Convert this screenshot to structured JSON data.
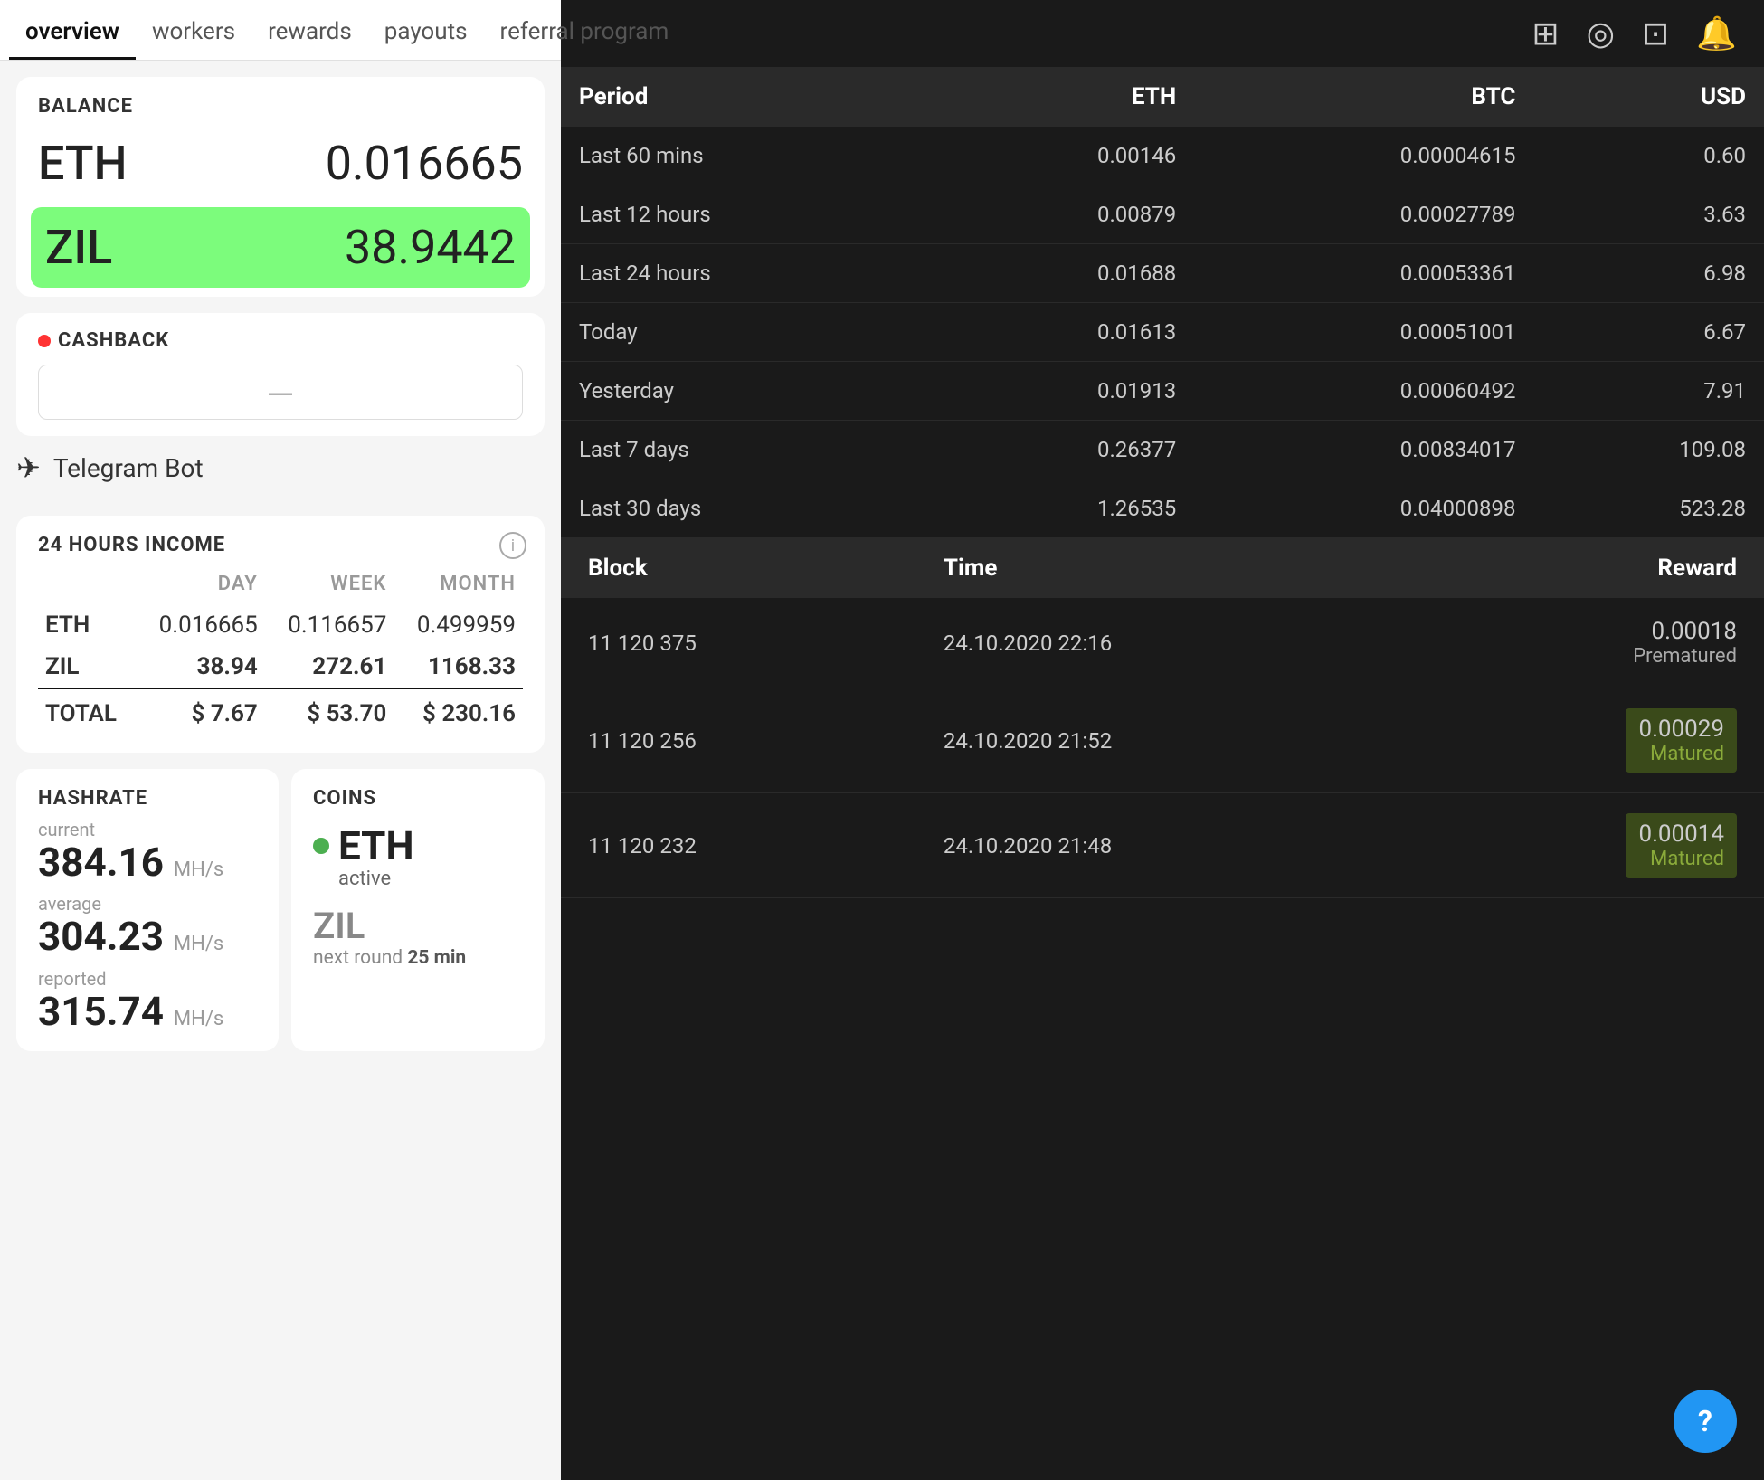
{
  "nav": {
    "tabs": [
      {
        "id": "overview",
        "label": "overview",
        "active": true
      },
      {
        "id": "workers",
        "label": "workers",
        "active": false
      },
      {
        "id": "rewards",
        "label": "rewards",
        "active": false
      },
      {
        "id": "payouts",
        "label": "payouts",
        "active": false
      },
      {
        "id": "referral",
        "label": "referral program",
        "active": false
      }
    ]
  },
  "balance": {
    "label": "BALANCE",
    "eth_coin": "ETH",
    "eth_amount": "0.016665",
    "zil_coin": "ZIL",
    "zil_amount": "38.9442"
  },
  "cashback": {
    "label": "CASHBACK",
    "placeholder": "—"
  },
  "telegram": {
    "label": "Telegram Bot"
  },
  "income": {
    "title": "24 HOURS INCOME",
    "headers": [
      "",
      "DAY",
      "WEEK",
      "MONTH"
    ],
    "rows": [
      {
        "coin": "ETH",
        "day": "0.016665",
        "week": "0.116657",
        "month": "0.499959"
      },
      {
        "coin": "ZIL",
        "day": "38.94",
        "week": "272.61",
        "month": "1168.33"
      },
      {
        "coin": "TOTAL",
        "day": "$ 7.67",
        "week": "$ 53.70",
        "month": "$ 230.16"
      }
    ]
  },
  "hashrate": {
    "title": "HASHRATE",
    "current_label": "current",
    "current_value": "384.16",
    "current_unit": "MH/s",
    "average_label": "average",
    "average_value": "304.23",
    "average_unit": "MH/s",
    "reported_label": "reported",
    "reported_value": "315.74",
    "reported_unit": "MH/s"
  },
  "coins": {
    "title": "COINS",
    "eth": {
      "name": "ETH",
      "status": "active",
      "active": true
    },
    "zil": {
      "name": "ZIL",
      "next_label": "next round",
      "next_value": "25 min"
    }
  },
  "right_header": {
    "icons": [
      "layers",
      "circle-arrows",
      "folder",
      "bell"
    ]
  },
  "earnings_table": {
    "headers": [
      "Period",
      "ETH",
      "BTC",
      "USD"
    ],
    "rows": [
      {
        "period": "Last 60 mins",
        "eth": "0.00146",
        "btc": "0.00004615",
        "usd": "0.60"
      },
      {
        "period": "Last 12 hours",
        "eth": "0.00879",
        "btc": "0.00027789",
        "usd": "3.63"
      },
      {
        "period": "Last 24 hours",
        "eth": "0.01688",
        "btc": "0.00053361",
        "usd": "6.98"
      },
      {
        "period": "Today",
        "eth": "0.01613",
        "btc": "0.00051001",
        "usd": "6.67"
      },
      {
        "period": "Yesterday",
        "eth": "0.01913",
        "btc": "0.00060492",
        "usd": "7.91"
      },
      {
        "period": "Last 7 days",
        "eth": "0.26377",
        "btc": "0.00834017",
        "usd": "109.08"
      },
      {
        "period": "Last 30 days",
        "eth": "1.26535",
        "btc": "0.04000898",
        "usd": "523.28"
      }
    ]
  },
  "blocks_table": {
    "headers": [
      "Block",
      "Time",
      "Reward"
    ],
    "rows": [
      {
        "block": "11 120 375",
        "time": "24.10.2020 22:16",
        "reward_amount": "0.00018",
        "reward_status": "Prematured",
        "matured": false
      },
      {
        "block": "11 120 256",
        "time": "24.10.2020 21:52",
        "reward_amount": "0.00029",
        "reward_status": "Matured",
        "matured": true
      },
      {
        "block": "11 120 232",
        "time": "24.10.2020 21:48",
        "reward_amount": "0.00014",
        "reward_status": "Matured",
        "matured": true
      }
    ]
  }
}
